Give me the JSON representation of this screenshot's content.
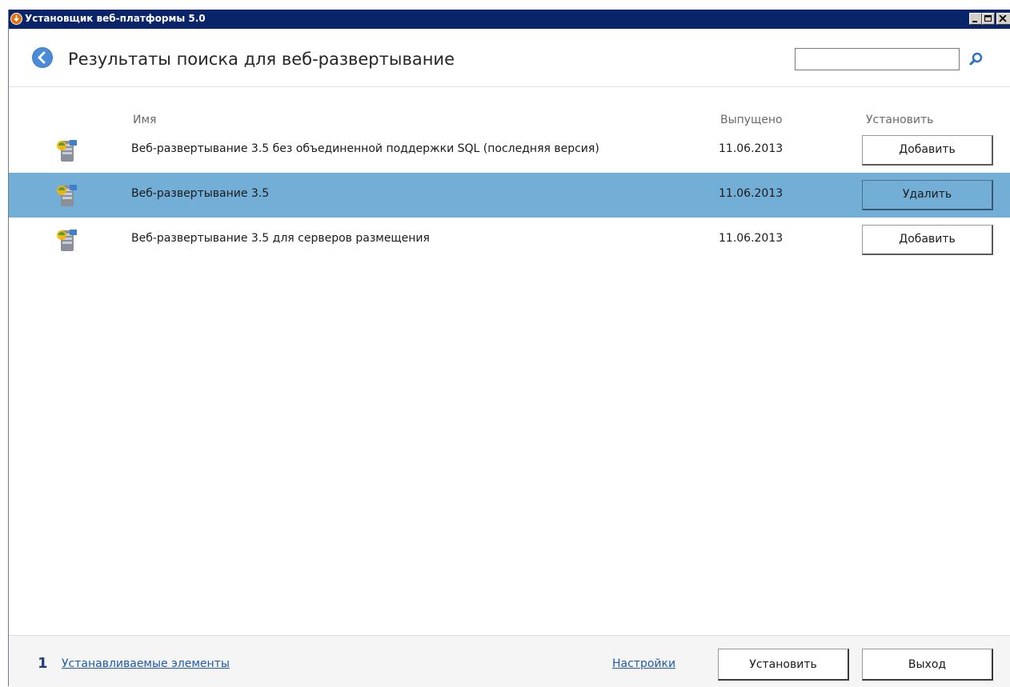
{
  "window": {
    "title": "Установщик веб-платформы 5.0",
    "icon": "webpi-orange-icon"
  },
  "header": {
    "title": "Результаты поиска для веб-развертывание",
    "search": {
      "value": "",
      "placeholder": ""
    },
    "back_icon": "back-arrow-icon",
    "search_icon": "search-icon"
  },
  "columns": {
    "name": "Имя",
    "released": "Выпущено",
    "install": "Установить"
  },
  "rows": [
    {
      "name": "Веб-развертывание 3.5 без объединенной поддержки SQL (последняя версия)",
      "date": "11.06.2013",
      "action": "Добавить",
      "selected": false
    },
    {
      "name": "Веб-развертывание 3.5",
      "date": "11.06.2013",
      "action": "Удалить",
      "selected": true
    },
    {
      "name": "Веб-развертывание 3.5 для серверов размещения",
      "date": "11.06.2013",
      "action": "Добавить",
      "selected": false
    }
  ],
  "footer": {
    "count": "1",
    "items_link": "Устанавливаемые элементы",
    "settings_link": "Настройки",
    "install_button": "Установить",
    "exit_button": "Выход"
  },
  "colors": {
    "titlebar": "#0a246a",
    "selected_row": "#73aed6",
    "link": "#1e5aa8"
  }
}
